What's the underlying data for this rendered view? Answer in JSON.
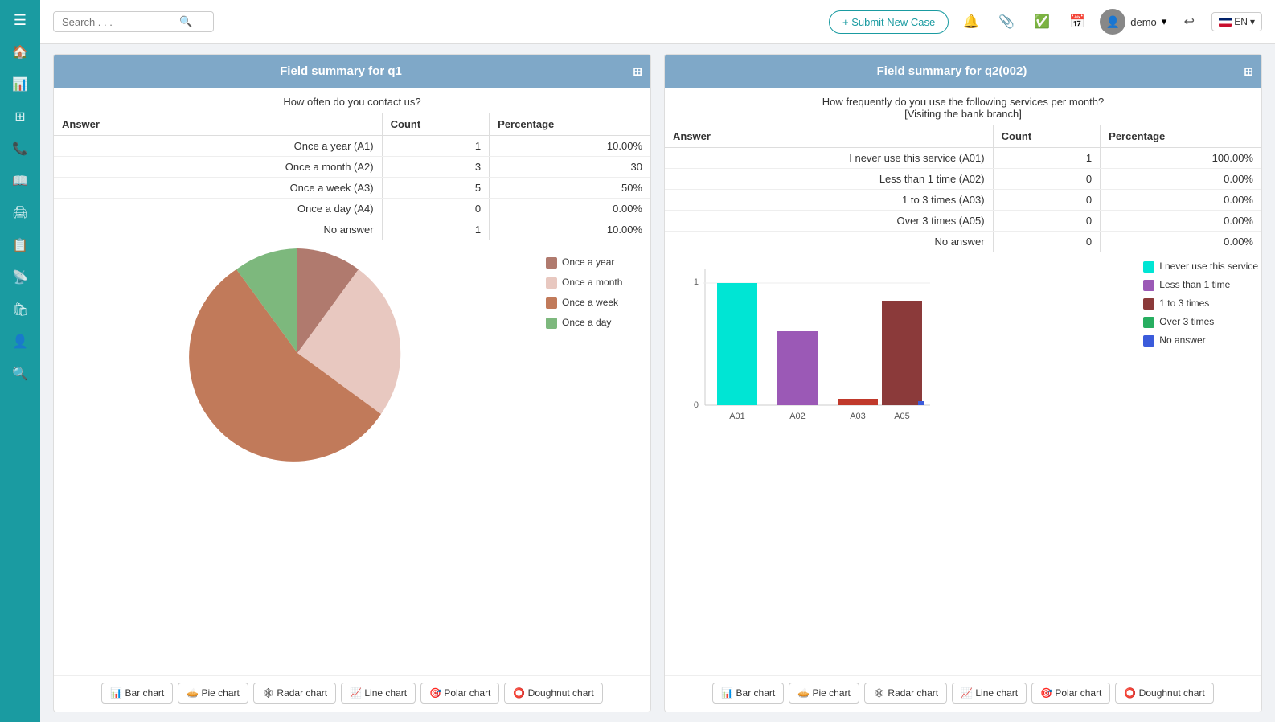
{
  "sidebar": {
    "menuIcon": "☰",
    "icons": [
      "🏠",
      "📊",
      "📋",
      "📞",
      "📖",
      "🖨",
      "📝",
      "📡",
      "🛍",
      "👤",
      "🔍"
    ]
  },
  "topnav": {
    "searchPlaceholder": "Search . . .",
    "submitBtn": "+ Submit New Case",
    "userName": "demo",
    "lang": "EN"
  },
  "card1": {
    "title": "Field summary for q1",
    "subtitle": "How often do you contact us?",
    "tableHeaders": [
      "Answer",
      "Count",
      "Percentage"
    ],
    "rows": [
      {
        "answer": "Once a year (A1)",
        "count": "1",
        "pct": "10.00%"
      },
      {
        "answer": "Once a month (A2)",
        "count": "3",
        "pct": "30"
      },
      {
        "answer": "Once a week (A3)",
        "count": "5",
        "pct": "50%"
      },
      {
        "answer": "Once a day (A4)",
        "count": "0",
        "pct": "0.00%"
      },
      {
        "answer": "No answer",
        "count": "1",
        "pct": "10.00%"
      }
    ],
    "legend": [
      {
        "label": "Once a year",
        "color": "#b07a6e"
      },
      {
        "label": "Once a month",
        "color": "#e8c8c0"
      },
      {
        "label": "Once a week",
        "color": "#c17a5a"
      },
      {
        "label": "Once a day",
        "color": "#7db87d"
      }
    ],
    "chartButtons": [
      "Bar chart",
      "Pie chart",
      "Radar chart",
      "Line chart",
      "Polar chart",
      "Doughnut chart"
    ]
  },
  "card2": {
    "title": "Field summary for q2(002)",
    "subtitle": "How frequently do you use the following services per month?",
    "subtitle2": "[Visiting the bank branch]",
    "tableHeaders": [
      "Answer",
      "Count",
      "Percentage"
    ],
    "rows": [
      {
        "answer": "I never use this service (A01)",
        "count": "1",
        "pct": "100.00%"
      },
      {
        "answer": "Less than 1 time (A02)",
        "count": "0",
        "pct": "0.00%"
      },
      {
        "answer": "1 to 3 times (A03)",
        "count": "0",
        "pct": "0.00%"
      },
      {
        "answer": "Over 3 times (A05)",
        "count": "0",
        "pct": "0.00%"
      },
      {
        "answer": "No answer",
        "count": "0",
        "pct": "0.00%"
      }
    ],
    "legend": [
      {
        "label": "I never use this service",
        "color": "#00e5d4"
      },
      {
        "label": "Less than 1 time",
        "color": "#9b59b6"
      },
      {
        "label": "1 to 3 times",
        "color": "#8b3a3a"
      },
      {
        "label": "Over 3 times",
        "color": "#27ae60"
      },
      {
        "label": "No answer",
        "color": "#3b5bdb"
      }
    ],
    "barLabels": [
      "A01",
      "A02",
      "A03",
      "A05"
    ],
    "barValues": [
      1,
      0.6,
      0.05,
      0.85
    ],
    "barColors": [
      "#00e5d4",
      "#9b59b6",
      "#8b3a3a",
      "#8b3a3a"
    ],
    "chartButtons": [
      "Bar chart",
      "Pie chart",
      "Radar chart",
      "Line chart",
      "Polar chart",
      "Doughnut chart"
    ]
  }
}
